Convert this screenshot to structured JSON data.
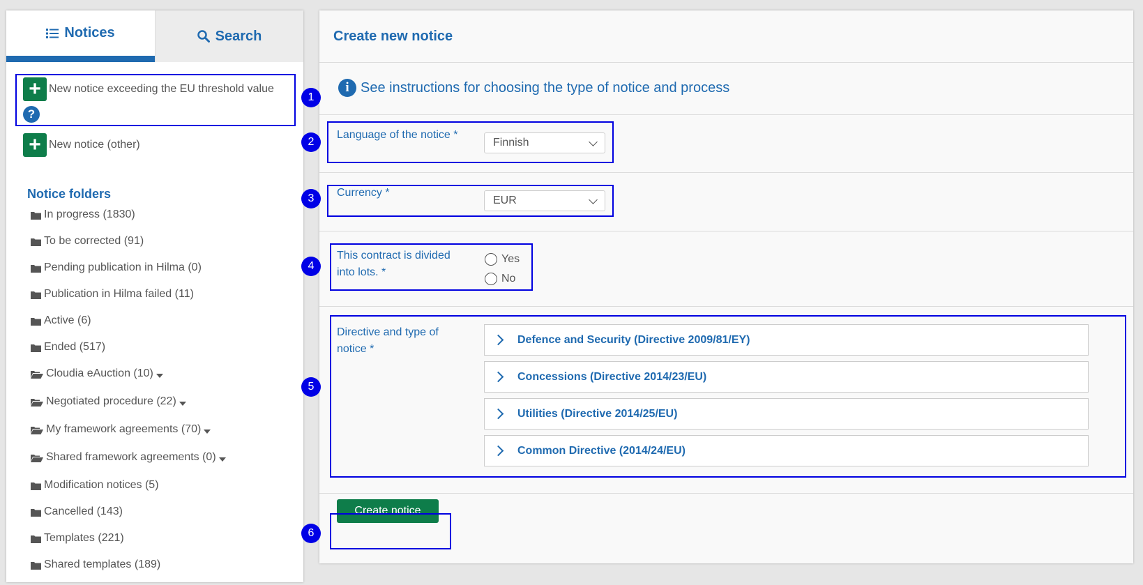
{
  "sidebar": {
    "tabs": [
      {
        "label": "Notices",
        "icon": "list-icon",
        "active": true
      },
      {
        "label": "Search",
        "icon": "search-icon",
        "active": false
      }
    ],
    "new_notice_eu": "New notice exceeding the EU threshold value",
    "new_notice_other": "New notice (other)",
    "folders_title": "Notice folders",
    "folders": [
      {
        "label": "In progress (1830)"
      },
      {
        "label": "To be corrected (91)"
      },
      {
        "label": "Pending publication in Hilma (0)"
      },
      {
        "label": "Publication in Hilma failed (11)"
      },
      {
        "label": "Active (6)"
      },
      {
        "label": "Ended (517)"
      },
      {
        "label": "Cloudia eAuction (10)"
      },
      {
        "label": "Negotiated procedure (22)"
      },
      {
        "label": "My framework agreements (70)"
      },
      {
        "label": "Shared framework agreements (0)"
      },
      {
        "label": "Modification notices (5)"
      },
      {
        "label": "Cancelled (143)"
      },
      {
        "label": "Templates (221)"
      },
      {
        "label": "Shared templates (189)"
      }
    ]
  },
  "main": {
    "title": "Create new notice",
    "instructions_link": "See instructions for choosing the type of notice and process",
    "language_label": "Language of the notice *",
    "language_value": "Finnish",
    "currency_label": "Currency *",
    "currency_value": "EUR",
    "lots_label_line1": "This contract is divided",
    "lots_label_line2": "into lots. *",
    "lots_options": [
      "Yes",
      "No"
    ],
    "directive_label_line1": "Directive and type of",
    "directive_label_line2": "notice *",
    "directives": [
      "Defence and Security (Directive 2009/81/EY)",
      "Concessions (Directive 2014/23/EU)",
      "Utilities (Directive 2014/25/EU)",
      "Common Directive (2014/24/EU)"
    ],
    "create_button": "Create notice"
  },
  "annotations": [
    "1",
    "2",
    "3",
    "4",
    "5",
    "6"
  ],
  "colors": {
    "brand_blue": "#1f6ab0",
    "button_green": "#0e7d4a",
    "annotation_blue": "#0000e0"
  }
}
